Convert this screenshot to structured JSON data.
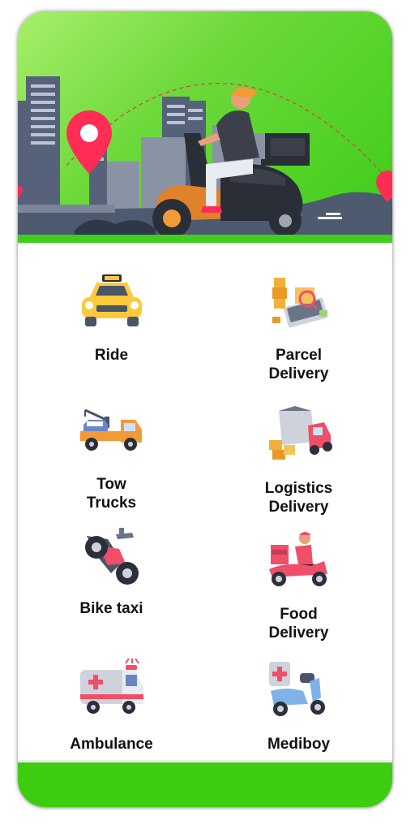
{
  "colors": {
    "accent": "#3ccc10",
    "hero_start": "#a8ef6a",
    "hero_end": "#3ccc17",
    "pin": "#ff2d55"
  },
  "services": [
    {
      "label_lines": [
        "Ride"
      ],
      "icon": "taxi-icon"
    },
    {
      "label_lines": [
        "Parcel",
        "Delivery"
      ],
      "icon": "parcel-icon"
    },
    {
      "label_lines": [
        "Tow",
        "Trucks"
      ],
      "icon": "tow-truck-icon"
    },
    {
      "label_lines": [
        "Logistics",
        "Delivery"
      ],
      "icon": "logistics-truck-icon"
    },
    {
      "label_lines": [
        "Bike taxi"
      ],
      "icon": "motorbike-icon"
    },
    {
      "label_lines": [
        "Food",
        "Delivery"
      ],
      "icon": "food-scooter-icon"
    },
    {
      "label_lines": [
        "Ambulance"
      ],
      "icon": "ambulance-icon"
    },
    {
      "label_lines": [
        "Mediboy"
      ],
      "icon": "medical-scooter-icon"
    }
  ]
}
